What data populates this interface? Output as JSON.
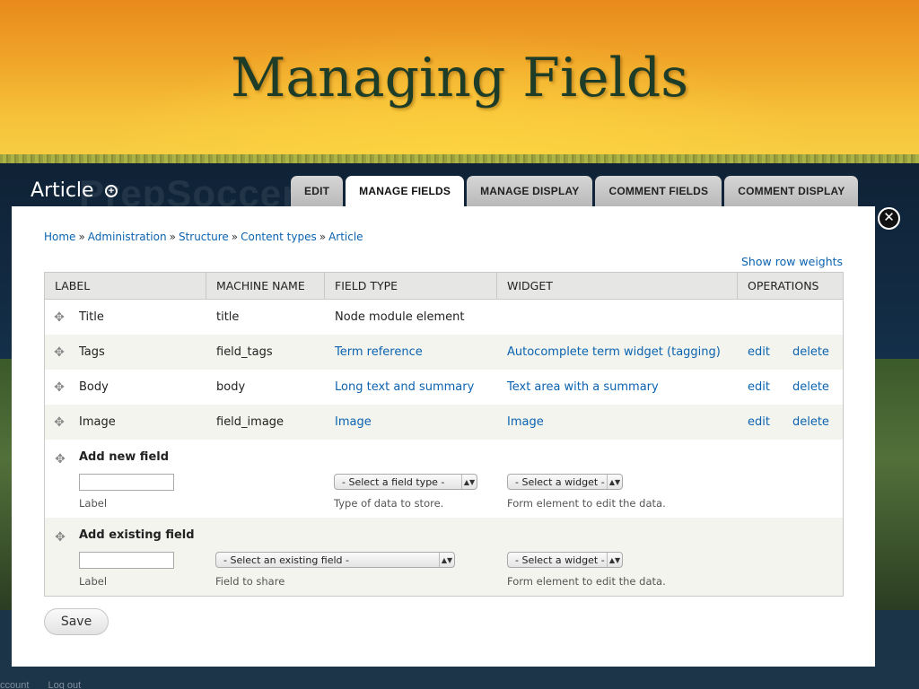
{
  "slide": {
    "title": "Managing Fields",
    "watermark": "PrepSoccer.c"
  },
  "page": {
    "title": "Article",
    "add_shortcut_icon": "plus-circle-icon",
    "close_icon": "close-icon"
  },
  "tabs": [
    {
      "label": "EDIT",
      "active": false
    },
    {
      "label": "MANAGE FIELDS",
      "active": true
    },
    {
      "label": "MANAGE DISPLAY",
      "active": false
    },
    {
      "label": "COMMENT FIELDS",
      "active": false
    },
    {
      "label": "COMMENT DISPLAY",
      "active": false
    }
  ],
  "breadcrumb": [
    "Home",
    "Administration",
    "Structure",
    "Content types",
    "Article"
  ],
  "breadcrumb_sep": "»",
  "show_row_weights": "Show row weights",
  "table": {
    "headers": [
      "LABEL",
      "MACHINE NAME",
      "FIELD TYPE",
      "WIDGET",
      "OPERATIONS"
    ],
    "rows": [
      {
        "label": "Title",
        "machine": "title",
        "type": "Node module element",
        "widget": "",
        "edit": "",
        "delete": ""
      },
      {
        "label": "Tags",
        "machine": "field_tags",
        "type": "Term reference",
        "widget": "Autocomplete term widget (tagging)",
        "edit": "edit",
        "delete": "delete"
      },
      {
        "label": "Body",
        "machine": "body",
        "type": "Long text and summary",
        "widget": "Text area with a summary",
        "edit": "edit",
        "delete": "delete"
      },
      {
        "label": "Image",
        "machine": "field_image",
        "type": "Image",
        "widget": "Image",
        "edit": "edit",
        "delete": "delete"
      }
    ]
  },
  "add_new": {
    "title": "Add new field",
    "label_desc": "Label",
    "type_select": "- Select a field type -",
    "type_desc": "Type of data to store.",
    "widget_select": "- Select a widget -",
    "widget_desc": "Form element to edit the data."
  },
  "add_existing": {
    "title": "Add existing field",
    "label_desc": "Label",
    "field_select": "- Select an existing field -",
    "field_desc": "Field to share",
    "widget_select": "- Select a widget -",
    "widget_desc": "Form element to edit the data."
  },
  "save_label": "Save",
  "footer": [
    "ccount",
    "Log out"
  ],
  "icons": {
    "drag": "drag-handle-icon",
    "select_arrow": "select-arrows-icon"
  },
  "colors": {
    "link": "#0b63b0",
    "title": "#1e3d28",
    "banner": "#f0a428"
  }
}
